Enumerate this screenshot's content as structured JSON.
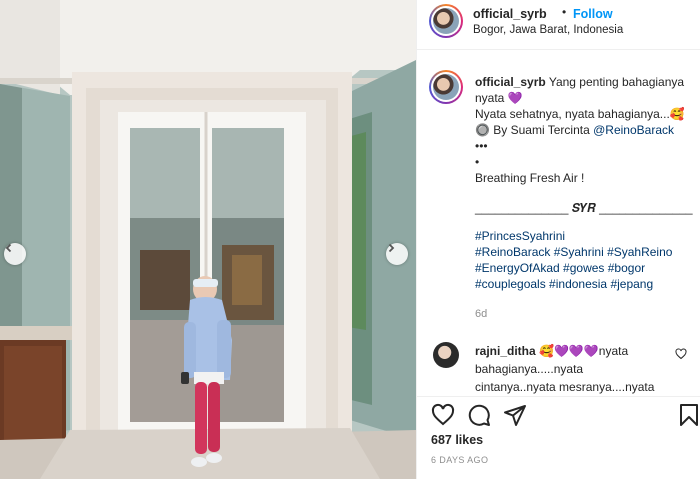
{
  "header": {
    "username": "official_syrb",
    "separator": "•",
    "follow_label": "Follow",
    "location": "Bogor, Jawa Barat, Indonesia"
  },
  "caption": {
    "username": "official_syrb",
    "text_1": "Yang penting bahagianya",
    "line_2": "nyata 💜",
    "line_3": "Nyata sehatnya, nyata bahagianya...🥰",
    "line_4_prefix": "🔘 By Suami Tercinta",
    "mention": "@ReinoBarack",
    "line_5": "•••",
    "line_6": "•",
    "line_7": "Breathing Fresh Air !",
    "signature": "______________  𝑺𝒀𝑹  ______________",
    "hashtags_1": "#PrincesSyahrini",
    "hashtags_2": "#ReinoBarack #Syahrini #SyahReino",
    "hashtags_3": "#EnergyOfAkad #gowes #bogor",
    "hashtags_4": "#couplegoals #indonesia #jepang",
    "age": "6d"
  },
  "comment": {
    "username": "rajni_ditha",
    "text_1": " 🥰💜💜💜nyata",
    "line_2": "bahagianya.....nyata",
    "line_3": "cintanya..nyata mesranya....nyata"
  },
  "footer": {
    "likes": "687 likes",
    "timestamp": "6 DAYS AGO"
  },
  "colors": {
    "follow_blue": "#0095f6",
    "link_blue": "#00376b",
    "muted_gray": "#8e8e8e",
    "jacket_blue": "#a9c1e6",
    "leggings_pink": "#d2355c"
  },
  "icons": [
    "chevron-left-icon",
    "chevron-right-icon",
    "heart-icon",
    "comment-icon",
    "share-icon",
    "bookmark-icon",
    "comment-like-heart-icon"
  ]
}
